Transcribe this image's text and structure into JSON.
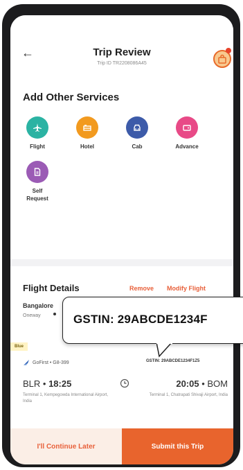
{
  "header": {
    "title": "Trip Review",
    "trip_id": "Trip ID TR2208086A45"
  },
  "services": {
    "title": "Add Other Services",
    "items": [
      {
        "label": "Flight",
        "icon": "plane-icon",
        "color": "#2bb3a3"
      },
      {
        "label": "Hotel",
        "icon": "hotel-icon",
        "color": "#f29a1f"
      },
      {
        "label": "Cab",
        "icon": "car-icon",
        "color": "#3d5ba9"
      },
      {
        "label": "Advance",
        "icon": "wallet-icon",
        "color": "#e84a87"
      },
      {
        "label": "Self Request",
        "icon": "document-icon",
        "color": "#9b5bb5"
      }
    ]
  },
  "flight": {
    "title": "Flight Details",
    "remove_label": "Remove",
    "modify_label": "Modify Flight",
    "route": "Bangalore",
    "trip_type": "Oneway",
    "tag": "Blue",
    "airline": "GoFirst • G8-399",
    "gstin_small": "GSTIN: 29ABCDE1234F1Z5",
    "dep_code": "BLR",
    "dep_time": "18:25",
    "arr_time": "20:05",
    "arr_code": "BOM",
    "dep_terminal": "Terminal 1, Kempegowda International Airport, India",
    "arr_terminal": "Terminal 1, Chatrapati Shivaji Airport, India"
  },
  "tooltip": {
    "text": "GSTIN: 29ABCDE1234F"
  },
  "bottom": {
    "later_label": "I'll Continue Later",
    "submit_label": "Submit this Trip"
  },
  "colors": {
    "accent": "#e8642d",
    "frame": "#1c1c1e"
  }
}
